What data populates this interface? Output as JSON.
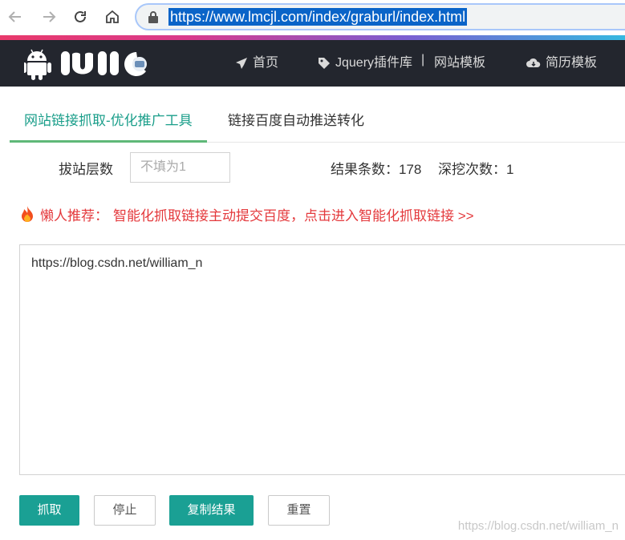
{
  "browser": {
    "url": "https://www.lmcjl.com/index/graburl/index.html"
  },
  "header": {
    "menu": [
      {
        "icon": "paper-plane-icon",
        "label": "首页"
      },
      {
        "icon": "tag-icon",
        "label": "Jquery插件库"
      },
      {
        "separator": "|"
      },
      {
        "label": "网站模板"
      },
      {
        "icon": "cloud-download-icon",
        "label": "简历模板"
      }
    ]
  },
  "tabs": [
    {
      "label": "网站链接抓取-优化推广工具",
      "active": true
    },
    {
      "label": "链接百度自动推送转化",
      "active": false
    }
  ],
  "form": {
    "depth_label": "拔站层数",
    "depth_placeholder": "不填为1",
    "result_count_label": "结果条数：178",
    "dig_count_label": "深挖次数：1"
  },
  "recommend": {
    "prefix": "懒人推荐：",
    "link_text": "智能化抓取链接主动提交百度，点击进入智能化抓取链接 >>"
  },
  "result": {
    "value": "https://blog.csdn.net/william_n"
  },
  "buttons": {
    "fetch": "抓取",
    "stop": "停止",
    "copy": "复制结果",
    "reset": "重置"
  },
  "watermark": "https://blog.csdn.net/william_n",
  "colors": {
    "accent": "#1aa094",
    "header_bg": "#23262e",
    "recommend_red": "#e4393c",
    "tab_active": "#5fb878"
  }
}
